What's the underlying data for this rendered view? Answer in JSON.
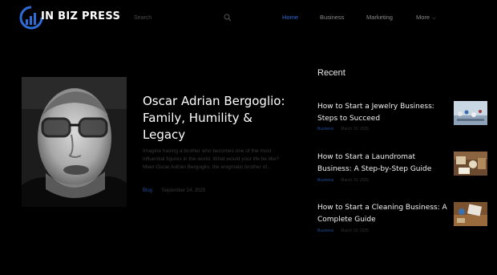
{
  "header": {
    "logo_text": "IN BIZ PRESS",
    "search_placeholder": "Search",
    "nav": [
      {
        "label": "Home",
        "active": true
      },
      {
        "label": "Business",
        "active": false
      },
      {
        "label": "Marketing",
        "active": false
      },
      {
        "label": "More",
        "active": false
      }
    ],
    "accent_color": "#2f6bd6"
  },
  "featured": {
    "title": "Oscar Adrian Bergoglio: Family, Humility & Legacy",
    "excerpt": "Imagine having a brother who becomes one of the most influential figures in the world. What would your life be like? Meet Oscar Adrián Bergoglio, the enigmatic brother of...",
    "category": "Blog",
    "date": "September 14, 2025"
  },
  "recent": {
    "heading": "Recent",
    "items": [
      {
        "title": "How to Start a Jewelry Business: Steps to Succeed",
        "category": "Business",
        "date": "March 19, 2025"
      },
      {
        "title": "How to Start a Laundromat Business: A Step-by-Step Guide",
        "category": "Business",
        "date": "March 19, 2025"
      },
      {
        "title": "How to Start a Cleaning Business: A Complete Guide",
        "category": "Business",
        "date": "March 19, 2025"
      }
    ]
  }
}
